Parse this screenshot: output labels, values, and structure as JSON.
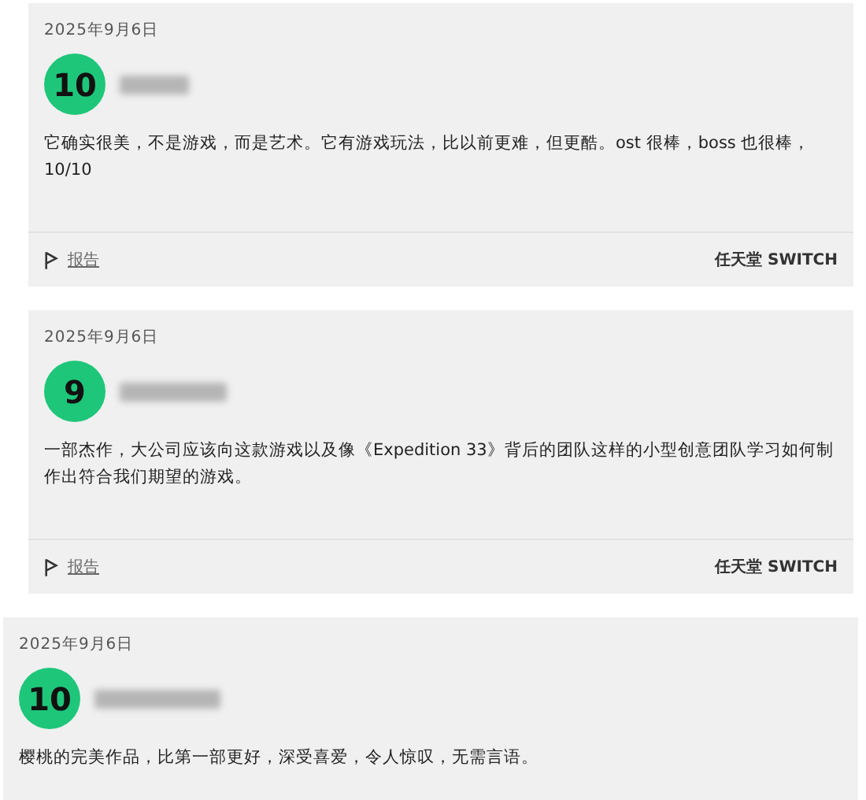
{
  "reviews": [
    {
      "date": "2025年9月6日",
      "score": "10",
      "text": "它确实很美，不是游戏，而是艺术。它有游戏玩法，比以前更难，但更酷。ost 很棒，boss 也很棒，10/10",
      "report": "报告",
      "platform": "任天堂 SWITCH"
    },
    {
      "date": "2025年9月6日",
      "score": "9",
      "text": "一部杰作，大公司应该向这款游戏以及像《Expedition 33》背后的团队这样的小型创意团队学习如何制作出符合我们期望的游戏。",
      "report": "报告",
      "platform": "任天堂 SWITCH"
    },
    {
      "date": "2025年9月6日",
      "score": "10",
      "text": "樱桃的完美作品，比第一部更好，深受喜爱，令人惊叹，无需言语。"
    }
  ]
}
